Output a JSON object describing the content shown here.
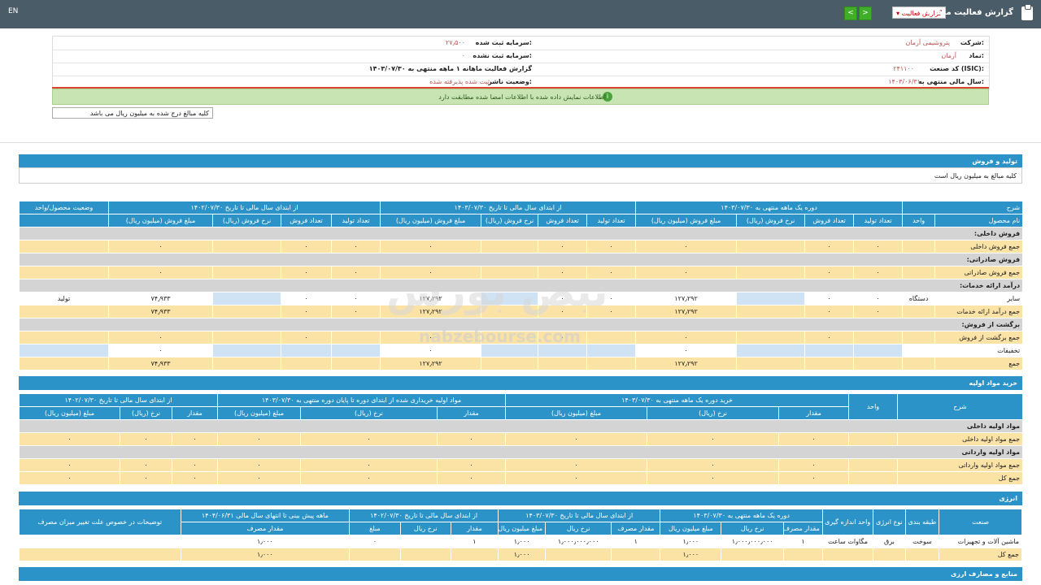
{
  "topbar": {
    "en": "EN",
    "title": "گزارش فعالیت ماهانه",
    "select": "گزارش فعالیت",
    "prev": "<",
    "next": ">"
  },
  "header": {
    "company_label": "شرکت:",
    "company_value": "پتروشیمی آرمان",
    "capital_label": "سرمایه ثبت شده:",
    "capital_value": "۲۷٫۵۰۰",
    "symbol_label": "نماد:",
    "symbol_value": "آرمان",
    "unreg_label": "سرمایه ثبت نشده:",
    "unreg_value": "۰",
    "isic_label": "کد صنعت (ISIC):",
    "isic_value": "۲۴۱۱۰۰",
    "report_label": "گزارش فعالیت ماهانه ۱ ماهه منتهی به ۱۴۰۳/۰۷/۳۰",
    "fy_label": "سال مالی منتهی به:",
    "fy_value": "۱۴۰۳/۰۶/۳۱",
    "status_label": "وضعیت ناشر:",
    "status_value": "ثبت شده پذیرفته شده"
  },
  "notice": "اطلاعات نمایش داده شده با اطلاعات امضا شده مطابقت دارد",
  "note": "کلیه مبالغ درج شده به میلیون ریال می باشد",
  "watermark": {
    "fa": "نبض بورس",
    "en": "nabzebourse.com"
  },
  "sections": {
    "production": "تولید و فروش",
    "production_sub": "کلیه مبالغ به میلیون ریال است",
    "materials": "خرید مواد اولیه",
    "energy": "انرژی",
    "sources": "منابع و مصارف ارزی"
  },
  "t1": {
    "h1": [
      "شرح",
      "دوره یک ماهه منتهی به ۱۴۰۳/۰۷/۳۰",
      "از ابتدای سال مالی تا تاریخ ۱۴۰۳/۰۷/۳۰",
      "از ابتدای سال مالی تا تاریخ ۱۴۰۲/۰۷/۳۰",
      "وضعیت محصول/واحد"
    ],
    "h2": [
      "نام محصول",
      "واحد",
      "تعداد تولید",
      "تعداد فروش",
      "نرخ فروش (ریال)",
      "مبلغ فروش (میلیون ریال)",
      "تعداد تولید",
      "تعداد فروش",
      "نرخ فروش (ریال)",
      "مبلغ فروش (میلیون ریال)",
      "تعداد تولید",
      "تعداد فروش",
      "نرخ فروش (ریال)",
      "مبلغ فروش (میلیون ریال)",
      ""
    ],
    "rows": [
      {
        "type": "gray",
        "label": "فروش داخلی:"
      },
      {
        "type": "yel",
        "cells": [
          "جمع فروش داخلی",
          "",
          "۰",
          "۰",
          "",
          "۰",
          "۰",
          "۰",
          "",
          "۰",
          "۰",
          "۰",
          "",
          "۰",
          ""
        ]
      },
      {
        "type": "gray",
        "label": "فروش صادراتی:"
      },
      {
        "type": "yel",
        "cells": [
          "جمع فروش صادراتی",
          "",
          "۰",
          "۰",
          "",
          "۰",
          "۰",
          "۰",
          "",
          "۰",
          "۰",
          "۰",
          "",
          "۰",
          ""
        ]
      },
      {
        "type": "gray",
        "label": "درآمد ارائه خدمات:"
      },
      {
        "type": "white",
        "cells": [
          "سایر",
          "دستگاه",
          "۰",
          "۰",
          "",
          "۱۲۷٫۲۹۲",
          "۰",
          "۰",
          "",
          "۱۲۷٫۲۹۲",
          "۰",
          "۰",
          "",
          "۷۴٫۹۳۳",
          "تولید"
        ]
      },
      {
        "type": "yel",
        "cells": [
          "جمع درآمد ارائه خدمات",
          "",
          "۰",
          "۰",
          "",
          "۱۲۷٫۲۹۲",
          "۰",
          "۰",
          "",
          "۱۲۷٫۲۹۲",
          "۰",
          "۰",
          "",
          "۷۴٫۹۳۳",
          ""
        ]
      },
      {
        "type": "gray",
        "label": "برگشت از فروش:"
      },
      {
        "type": "yel",
        "cells": [
          "جمع برگشت از فروش",
          "",
          "",
          "۰",
          "",
          "۰",
          "",
          "۰",
          "",
          "۰",
          "",
          "۰",
          "",
          "۰",
          ""
        ]
      },
      {
        "type": "white",
        "cells": [
          "تخفیفات",
          "",
          "",
          "",
          "",
          "۰",
          "",
          "",
          "",
          "۰",
          "",
          "",
          "",
          "۰",
          ""
        ]
      },
      {
        "type": "yel",
        "cells": [
          "جمع",
          "",
          "",
          "",
          "",
          "۱۲۷٫۲۹۲",
          "",
          "",
          "",
          "۱۲۷٫۲۹۲",
          "",
          "",
          "",
          "۷۴٫۹۳۳",
          ""
        ]
      }
    ]
  },
  "t2": {
    "h1": [
      "شرح",
      "واحد",
      "خرید دوره یک ماهه منتهی به ۱۴۰۳/۰۷/۳۰",
      "مواد اولیه خریداری شده از ابتدای دوره تا پایان دوره منتهی به ۱۴۰۳/۰۷/۳۰",
      "از ابتدای سال مالی تا تاریخ ۱۴۰۲/۰۷/۳۰"
    ],
    "h2": [
      "",
      "",
      "مقدار",
      "نرخ (ریال)",
      "مبلغ (میلیون ریال)",
      "مقدار",
      "نرخ (ریال)",
      "مبلغ (میلیون ریال)",
      "مقدار",
      "نرخ (ریال)",
      "مبلغ (میلیون ریال)"
    ],
    "rows": [
      {
        "type": "gray",
        "label": "مواد اولیه داخلی"
      },
      {
        "type": "yel",
        "cells": [
          "جمع مواد اولیه داخلی",
          "",
          "۰",
          "۰",
          "۰",
          "۰",
          "۰",
          "۰",
          "۰",
          "۰",
          "۰"
        ]
      },
      {
        "type": "gray",
        "label": "مواد اولیه وارداتی"
      },
      {
        "type": "yel",
        "cells": [
          "جمع مواد اولیه وارداتی",
          "",
          "۰",
          "۰",
          "۰",
          "۰",
          "۰",
          "۰",
          "۰",
          "۰",
          "۰"
        ]
      },
      {
        "type": "yel",
        "cells": [
          "جمع کل",
          "",
          "۰",
          "۰",
          "۰",
          "۰",
          "۰",
          "۰",
          "۰",
          "۰",
          "۰"
        ]
      }
    ]
  },
  "t3": {
    "h1": [
      "صنعت",
      "طبقه بندی",
      "نوع انرژی",
      "واحد اندازه گیری",
      "دوره یک ماهه منتهی به ۱۴۰۳/۰۷/۳۰",
      "از ابتدای سال مالی تا تاریخ ۱۴۰۳/۰۷/۳۰",
      "از ابتدای سال مالی تا تاریخ ۱۴۰۲/۰۷/۳۰",
      "ماهه پیش بینی تا انتهای سال مالی ۱۴۰۴/۰۶/۳۱",
      "توضیحات در خصوص علت تغییر میزان مصرف"
    ],
    "h2": [
      "",
      "",
      "",
      "",
      "مقدار مصرف",
      "نرخ ریال",
      "مبلغ میلیون ریال",
      "مقدار مصرف",
      "نرخ ریال",
      "مبلغ میلیون ریال",
      "مقدار",
      "نرخ ریال",
      "مبلغ",
      "مقدار مصرف",
      ""
    ],
    "rows": [
      {
        "type": "white",
        "cells": [
          "ماشین آلات و تجهیزات",
          "سوخت",
          "برق",
          "مگاوات ساعت",
          "۱",
          "۱٫۰۰۰٫۰۰۰٫۰۰۰",
          "۱٫۰۰۰",
          "۱",
          "۱٫۰۰۰٫۰۰۰٫۰۰۰",
          "۱٫۰۰۰",
          "۱",
          "",
          "۰",
          "۱٫۰۰۰",
          ""
        ]
      },
      {
        "type": "yel",
        "cells": [
          "جمع کل",
          "",
          "",
          "",
          "",
          "",
          "۱٫۰۰۰",
          "",
          "",
          "۱٫۰۰۰",
          "",
          "",
          "",
          "۱٫۰۰۰",
          ""
        ]
      }
    ]
  }
}
